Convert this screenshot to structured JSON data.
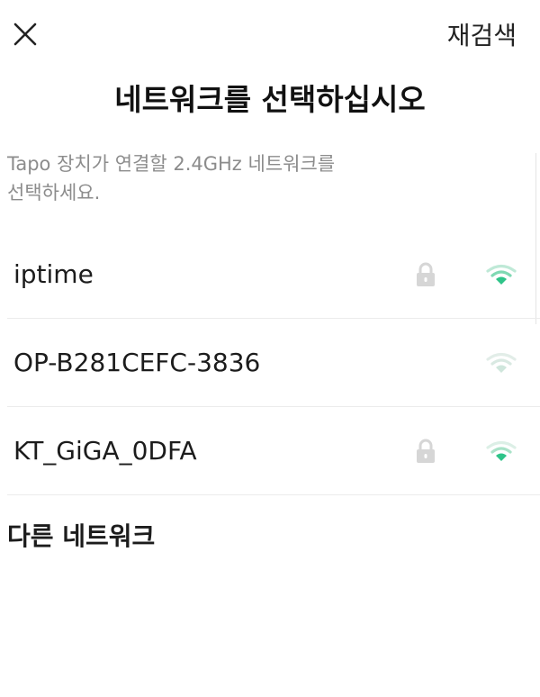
{
  "header": {
    "close_icon": "close-icon",
    "rescan_label": "재검색"
  },
  "title": "네트워크를 선택하십시오",
  "instruction": "Tapo 장치가 연결할 2.4GHz 네트워크를\n선택하세요.",
  "networks": [
    {
      "ssid": "iptime",
      "secured": true,
      "signal": "strong",
      "lock_icon": "lock-icon",
      "wifi_icon": "wifi-icon"
    },
    {
      "ssid": "OP-B281CEFC-3836",
      "secured": false,
      "signal": "weak",
      "wifi_icon": "wifi-icon"
    },
    {
      "ssid": "KT_GiGA_0DFA",
      "secured": true,
      "signal": "medium",
      "lock_icon": "lock-icon",
      "wifi_icon": "wifi-icon"
    }
  ],
  "other_network_label": "다른 네트워크",
  "colors": {
    "accent": "#2fc489",
    "wifi_inactive": "#d9e9e2",
    "lock": "#d6d6d6",
    "text_muted": "#8c8c8c"
  }
}
